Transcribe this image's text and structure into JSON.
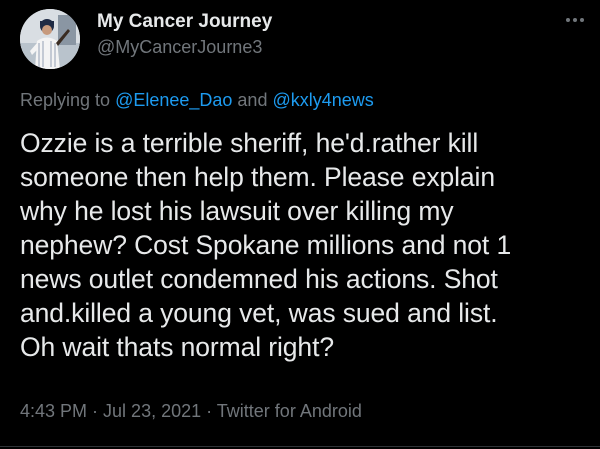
{
  "author": {
    "display_name": "My Cancer Journey",
    "handle": "@MyCancerJourne3"
  },
  "reply": {
    "prefix": "Replying to ",
    "mention_1": "@Elenee_Dao",
    "joiner": " and ",
    "mention_2": "@kxly4news"
  },
  "tweet": {
    "lines": [
      "Ozzie is a terrible sheriff, he'd.rather kill",
      "someone then help them. Please explain",
      "why he lost his lawsuit over killing my",
      "nephew? Cost Spokane millions and not 1",
      "news outlet condemned his actions. Shot",
      "and.killed a young vet, was sued and list.",
      "Oh wait thats normal right?"
    ]
  },
  "meta": {
    "time": "4:43 PM",
    "sep": " · ",
    "date": "Jul 23, 2021",
    "source": "Twitter for Android"
  },
  "icons": {
    "more": "more-horizontal-icon"
  },
  "colors": {
    "background": "#000000",
    "text": "#e7e9ea",
    "secondary": "#71767b",
    "link": "#1d9bf0"
  }
}
